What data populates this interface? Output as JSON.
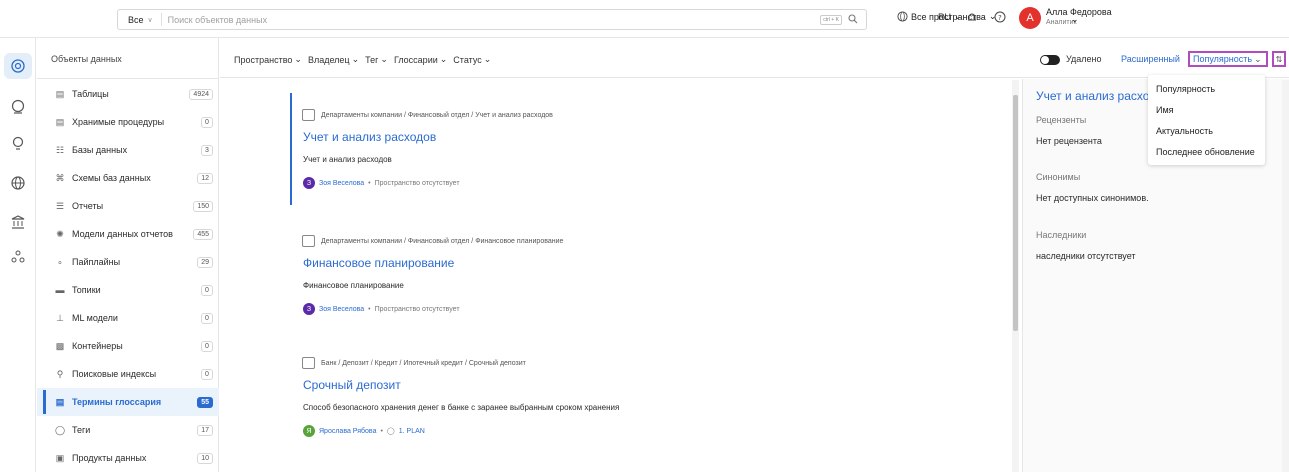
{
  "header": {
    "search_scope": "Все",
    "search_placeholder": "Поиск объектов данных",
    "search_kbd": "ctrl + K",
    "spaces_label": "Все пространства",
    "lang": "RU",
    "user_initial": "А",
    "user_name": "Алла Федорова",
    "user_role": "Аналитик"
  },
  "sidebar": {
    "title": "Объекты данных",
    "items": [
      {
        "label": "Таблицы",
        "count": "4924",
        "icon": "table-icon"
      },
      {
        "label": "Хранимые процедуры",
        "count": "0",
        "icon": "procedure-icon"
      },
      {
        "label": "Базы данных",
        "count": "3",
        "icon": "database-icon"
      },
      {
        "label": "Схемы баз данных",
        "count": "12",
        "icon": "schema-icon"
      },
      {
        "label": "Отчеты",
        "count": "150",
        "icon": "report-icon"
      },
      {
        "label": "Модели данных отчетов",
        "count": "455",
        "icon": "data-model-icon"
      },
      {
        "label": "Пайплайны",
        "count": "29",
        "icon": "pipeline-icon"
      },
      {
        "label": "Топики",
        "count": "0",
        "icon": "topic-icon"
      },
      {
        "label": "ML модели",
        "count": "0",
        "icon": "ml-model-icon"
      },
      {
        "label": "Контейнеры",
        "count": "0",
        "icon": "container-icon"
      },
      {
        "label": "Поисковые индексы",
        "count": "0",
        "icon": "search-index-icon"
      },
      {
        "label": "Термины глоссария",
        "count": "55",
        "icon": "glossary-term-icon"
      },
      {
        "label": "Теги",
        "count": "17",
        "icon": "tag-icon"
      },
      {
        "label": "Продукты данных",
        "count": "10",
        "icon": "data-product-icon"
      }
    ]
  },
  "filters": [
    "Пространство",
    "Владелец",
    "Тег",
    "Глоссарии",
    "Статус"
  ],
  "toolbar": {
    "deleted_label": "Удалено",
    "advanced_label": "Расширенный",
    "sort_label": "Популярность"
  },
  "sort_menu": [
    "Популярность",
    "Имя",
    "Актуальность",
    "Последнее обновление"
  ],
  "results": [
    {
      "breadcrumb": "Департаменты компании / Финансовый отдел / Учет и анализ расходов",
      "title": "Учет и анализ расходов",
      "description": "Учет и анализ расходов",
      "owner_initial": "З",
      "owner": "Зоя Веселова",
      "space": "Пространство отсутствует",
      "avatar_color": "#5b2aa8"
    },
    {
      "breadcrumb": "Департаменты компании / Финансовый отдел / Финансовое планирование",
      "title": "Финансовое планирование",
      "description": "Финансовое планирование",
      "owner_initial": "З",
      "owner": "Зоя Веселова",
      "space": "Пространство отсутствует",
      "avatar_color": "#5b2aa8"
    },
    {
      "breadcrumb": "Банк / Депозит / Кредит / Ипотечный кредит / Срочный депозит",
      "title": "Срочный депозит",
      "description": "Способ безопасного хранения денег в банке с заранее выбранным сроком хранения",
      "owner_initial": "Я",
      "owner": "Ярослава Рябова",
      "space": "1. PLAN",
      "avatar_color": "#58a33a"
    }
  ],
  "detail": {
    "title": "Учет и анализ расходов",
    "reviewers_label": "Рецензенты",
    "reviewers_value": "Нет рецензента",
    "synonyms_label": "Синонимы",
    "synonyms_value": "Нет доступных синонимов.",
    "children_label": "Наследники",
    "children_value": "наследники отсутствует"
  }
}
